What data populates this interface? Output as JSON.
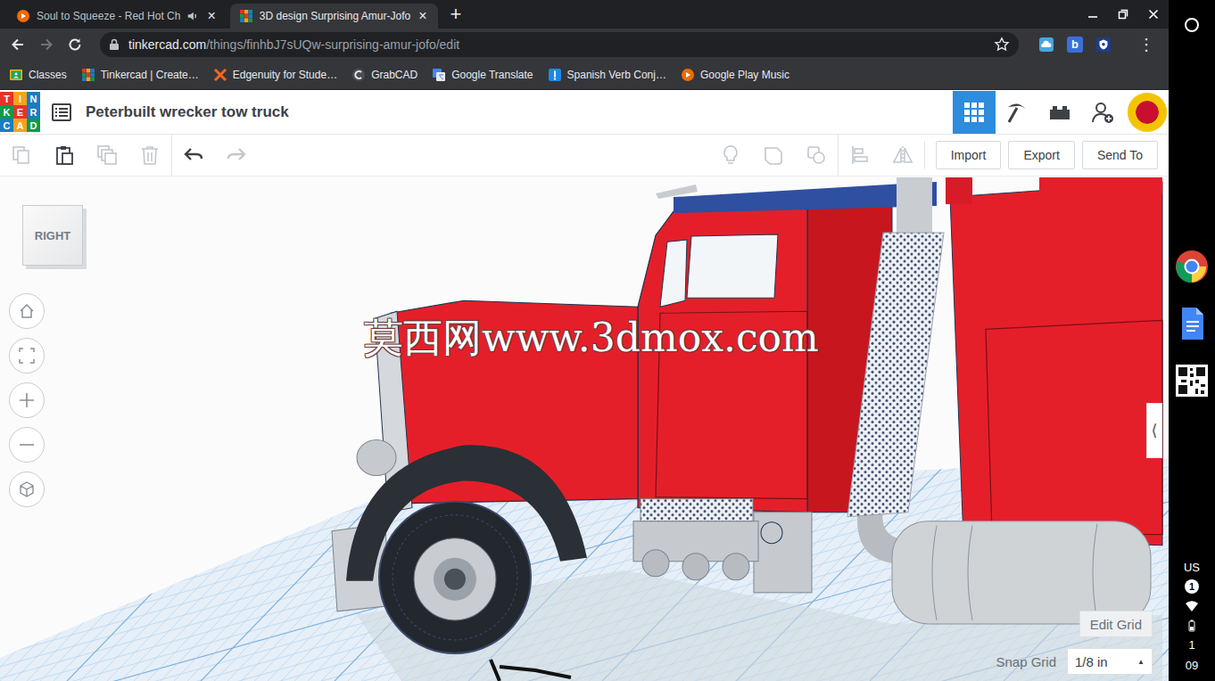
{
  "browser": {
    "tabs": [
      {
        "label": "Soul to Squeeze - Red Hot Ch",
        "selected": false,
        "favicon": "music",
        "playing_audio": true
      },
      {
        "label": "3D design Surprising Amur-Jofo",
        "selected": true,
        "favicon": "tinkercad",
        "playing_audio": false
      }
    ],
    "tab_close": "×",
    "new_tab": "+",
    "back_disabled": false,
    "forward_disabled": true,
    "address": {
      "host": "tinkercad.com",
      "path": "/things/finhbJ7sUQw-surprising-amur-jofo/edit",
      "secure": true
    },
    "starred": false,
    "extensions": [
      {
        "kind": "cloud"
      },
      {
        "kind": "letter",
        "label": "b"
      },
      {
        "kind": "shield"
      }
    ],
    "menu": "⋮",
    "bookmarks": [
      {
        "label": "Classes",
        "favicon": "classroom"
      },
      {
        "label": "Tinkercad | Create…",
        "favicon": "tinkercad"
      },
      {
        "label": "Edgenuity for Stude…",
        "favicon": "edgenuity"
      },
      {
        "label": "GrabCAD",
        "favicon": "grabcad"
      },
      {
        "label": "Google Translate",
        "favicon": "translate"
      },
      {
        "label": "Spanish Verb Conj…",
        "favicon": "verbs"
      },
      {
        "label": "Google Play Music",
        "favicon": "music"
      }
    ]
  },
  "app": {
    "logo": [
      [
        "T",
        "I",
        "N"
      ],
      [
        "K",
        "E",
        "R"
      ],
      [
        "C",
        "A",
        "D"
      ]
    ],
    "title": "Peterbuilt wrecker tow truck",
    "views": [
      {
        "kind": "design",
        "selected": true
      },
      {
        "kind": "pickaxe",
        "selected": false
      },
      {
        "kind": "bricks",
        "selected": false
      }
    ],
    "edit_tools": [
      {
        "kind": "copy",
        "disabled": true
      },
      {
        "kind": "paste",
        "disabled": false
      },
      {
        "kind": "duplicate",
        "disabled": true
      },
      {
        "kind": "delete",
        "disabled": true
      },
      {
        "kind": "undo",
        "disabled": false
      },
      {
        "kind": "redo",
        "disabled": true
      }
    ],
    "view_tools": [
      {
        "kind": "notes",
        "disabled": true
      },
      {
        "kind": "group",
        "disabled": true
      },
      {
        "kind": "ungroup",
        "disabled": true
      },
      {
        "kind": "align",
        "disabled": true
      },
      {
        "kind": "mirror",
        "disabled": true
      }
    ],
    "actions": [
      "Import",
      "Export",
      "Send To"
    ],
    "viewport": {
      "view_cube": "RIGHT",
      "nav_buttons": [
        {
          "kind": "home"
        },
        {
          "kind": "fit"
        },
        {
          "kind": "zoom-in"
        },
        {
          "kind": "zoom-out"
        },
        {
          "kind": "projection"
        }
      ],
      "panel_toggle": "⟨",
      "watermark": "莫西网www.3dmox.com",
      "edit_grid": "Edit Grid",
      "snap_label": "Snap Grid",
      "snap_value": "1/8 in",
      "snap_caret": "▲"
    }
  },
  "shelf": {
    "apps": [
      {
        "kind": "chrome"
      },
      {
        "kind": "docs"
      },
      {
        "kind": "qr"
      }
    ],
    "ime": "US",
    "notifications": "1",
    "time_hours": "1",
    "time_minutes": "09"
  }
}
